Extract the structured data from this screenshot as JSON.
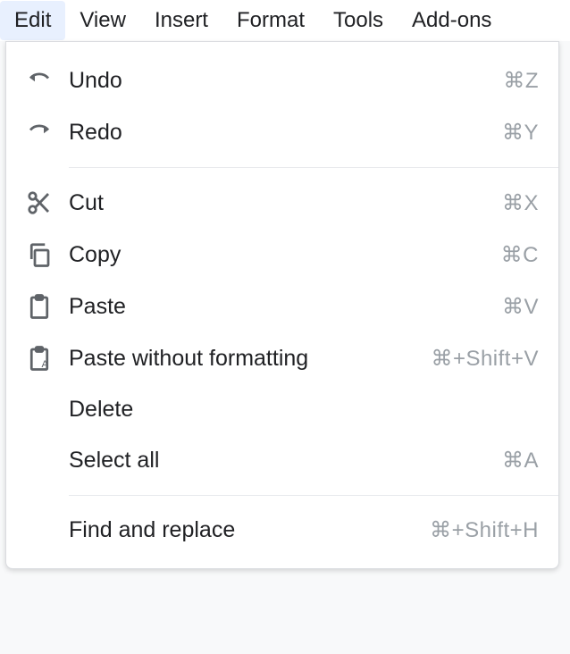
{
  "menubar": {
    "items": [
      {
        "label": "Edit",
        "name": "menu-edit",
        "active": true
      },
      {
        "label": "View",
        "name": "menu-view",
        "active": false
      },
      {
        "label": "Insert",
        "name": "menu-insert",
        "active": false
      },
      {
        "label": "Format",
        "name": "menu-format",
        "active": false
      },
      {
        "label": "Tools",
        "name": "menu-tools",
        "active": false
      },
      {
        "label": "Add-ons",
        "name": "menu-addons",
        "active": false
      }
    ]
  },
  "dropdown": {
    "items": [
      {
        "label": "Undo",
        "shortcut": "⌘Z",
        "icon": "undo-icon",
        "name": "menuitem-undo"
      },
      {
        "label": "Redo",
        "shortcut": "⌘Y",
        "icon": "redo-icon",
        "name": "menuitem-redo"
      },
      {
        "divider": true
      },
      {
        "label": "Cut",
        "shortcut": "⌘X",
        "icon": "cut-icon",
        "name": "menuitem-cut"
      },
      {
        "label": "Copy",
        "shortcut": "⌘C",
        "icon": "copy-icon",
        "name": "menuitem-copy"
      },
      {
        "label": "Paste",
        "shortcut": "⌘V",
        "icon": "paste-icon",
        "name": "menuitem-paste"
      },
      {
        "label": "Paste without formatting",
        "shortcut": "⌘+Shift+V",
        "icon": "paste-no-format-icon",
        "name": "menuitem-paste-no-format"
      },
      {
        "label": "Delete",
        "shortcut": "",
        "icon": "",
        "name": "menuitem-delete"
      },
      {
        "label": "Select all",
        "shortcut": "⌘A",
        "icon": "",
        "name": "menuitem-select-all"
      },
      {
        "divider": true
      },
      {
        "label": "Find and replace",
        "shortcut": "⌘+Shift+H",
        "icon": "",
        "name": "menuitem-find-replace"
      }
    ]
  }
}
